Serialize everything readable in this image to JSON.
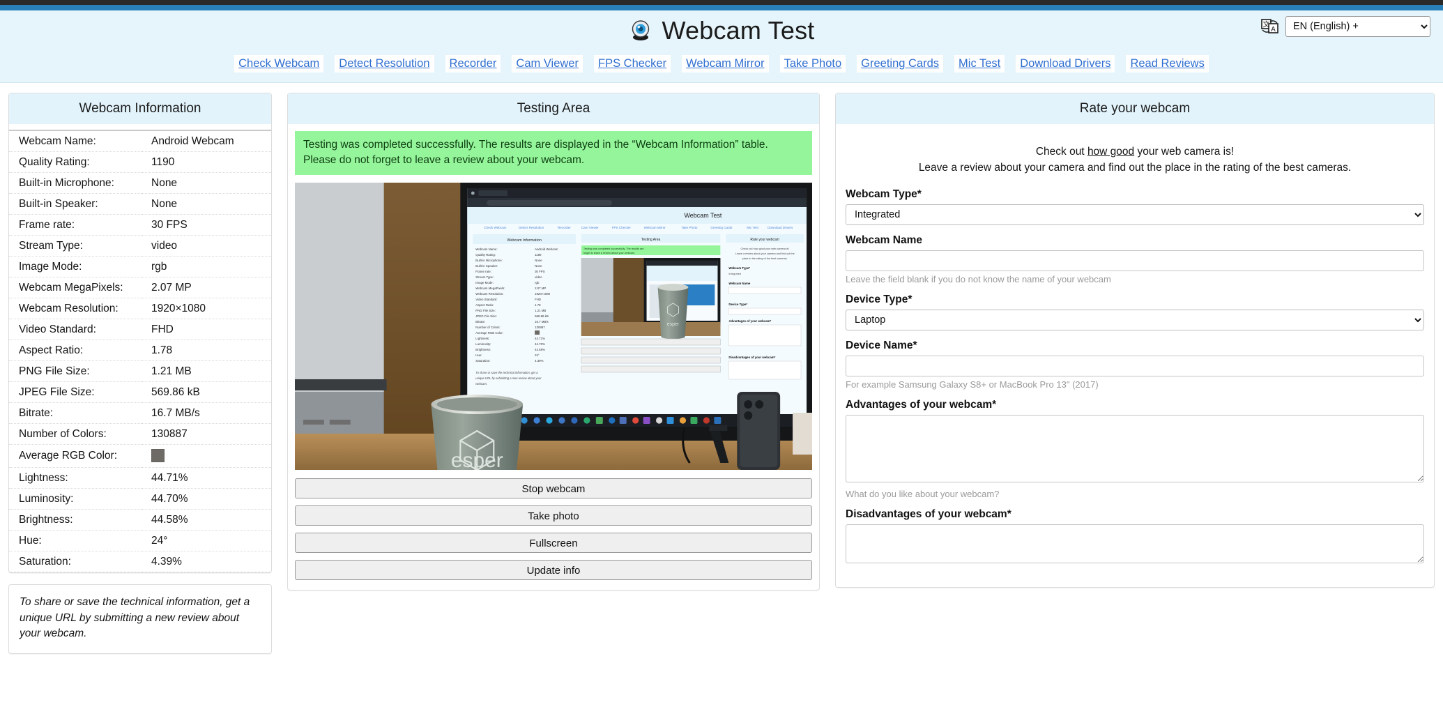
{
  "header": {
    "title": "Webcam Test",
    "logo_icon": "webcam-icon",
    "language_icon": "translate-icon",
    "language_selected": "EN (English) +"
  },
  "nav": {
    "items": [
      "Check Webcam",
      "Detect Resolution",
      "Recorder",
      "Cam Viewer",
      "FPS Checker",
      "Webcam Mirror",
      "Take Photo",
      "Greeting Cards",
      "Mic Test",
      "Download Drivers",
      "Read Reviews"
    ]
  },
  "webcam_information": {
    "heading": "Webcam Information",
    "rows": [
      {
        "key": "Webcam Name:",
        "value": "Android Webcam"
      },
      {
        "key": "Quality Rating:",
        "value": "1190"
      },
      {
        "key": "Built-in Microphone:",
        "value": "None"
      },
      {
        "key": "Built-in Speaker:",
        "value": "None"
      },
      {
        "key": "Frame rate:",
        "value": "30 FPS"
      },
      {
        "key": "Stream Type:",
        "value": "video"
      },
      {
        "key": "Image Mode:",
        "value": "rgb"
      },
      {
        "key": "Webcam MegaPixels:",
        "value": "2.07 MP"
      },
      {
        "key": "Webcam Resolution:",
        "value": "1920×1080"
      },
      {
        "key": "Video Standard:",
        "value": "FHD"
      },
      {
        "key": "Aspect Ratio:",
        "value": "1.78"
      },
      {
        "key": "PNG File Size:",
        "value": "1.21 MB"
      },
      {
        "key": "JPEG File Size:",
        "value": "569.86 kB"
      },
      {
        "key": "Bitrate:",
        "value": "16.7 MB/s"
      },
      {
        "key": "Number of Colors:",
        "value": "130887"
      },
      {
        "key": "Average RGB Color:",
        "value": "",
        "swatch": "#6e6a66"
      },
      {
        "key": "Lightness:",
        "value": "44.71%"
      },
      {
        "key": "Luminosity:",
        "value": "44.70%"
      },
      {
        "key": "Brightness:",
        "value": "44.58%"
      },
      {
        "key": "Hue:",
        "value": "24°"
      },
      {
        "key": "Saturation:",
        "value": "4.39%"
      }
    ],
    "share_note": "To share or save the technical information, get a unique URL by submitting a new review about your webcam."
  },
  "testing_area": {
    "heading": "Testing Area",
    "success_message": "Testing was completed successfully. The results are displayed in the “Webcam Information” table. Please do not forget to leave a review about your webcam.",
    "buttons": [
      "Stop webcam",
      "Take photo",
      "Fullscreen",
      "Update info"
    ]
  },
  "rate_panel": {
    "heading": "Rate your webcam",
    "intro_line1_a": "Check out ",
    "intro_link": "how good",
    "intro_line1_b": " your web camera is!",
    "intro_line2": "Leave a review about your camera and find out the place in the rating of the best cameras.",
    "webcam_type_label": "Webcam Type*",
    "webcam_type_value": "Integrated",
    "webcam_name_label": "Webcam Name",
    "webcam_name_value": "",
    "webcam_name_hint": "Leave the field blank if you do not know the name of your webcam",
    "device_type_label": "Device Type*",
    "device_type_value": "Laptop",
    "device_name_label": "Device Name*",
    "device_name_value": "",
    "device_name_hint": "For example Samsung Galaxy S8+ or MacBook Pro 13\" (2017)",
    "advantages_label": "Advantages of your webcam*",
    "advantages_value": "",
    "advantages_hint": "What do you like about your webcam?",
    "disadvantages_label": "Disadvantages of your webcam*",
    "disadvantages_value": ""
  },
  "colors": {
    "accent_bar": "#2980b9",
    "panel_header_bg": "#e2f3fb",
    "header_bg": "#e6f5fb",
    "success_bg": "#95f59a",
    "link": "#2f6fd0"
  }
}
